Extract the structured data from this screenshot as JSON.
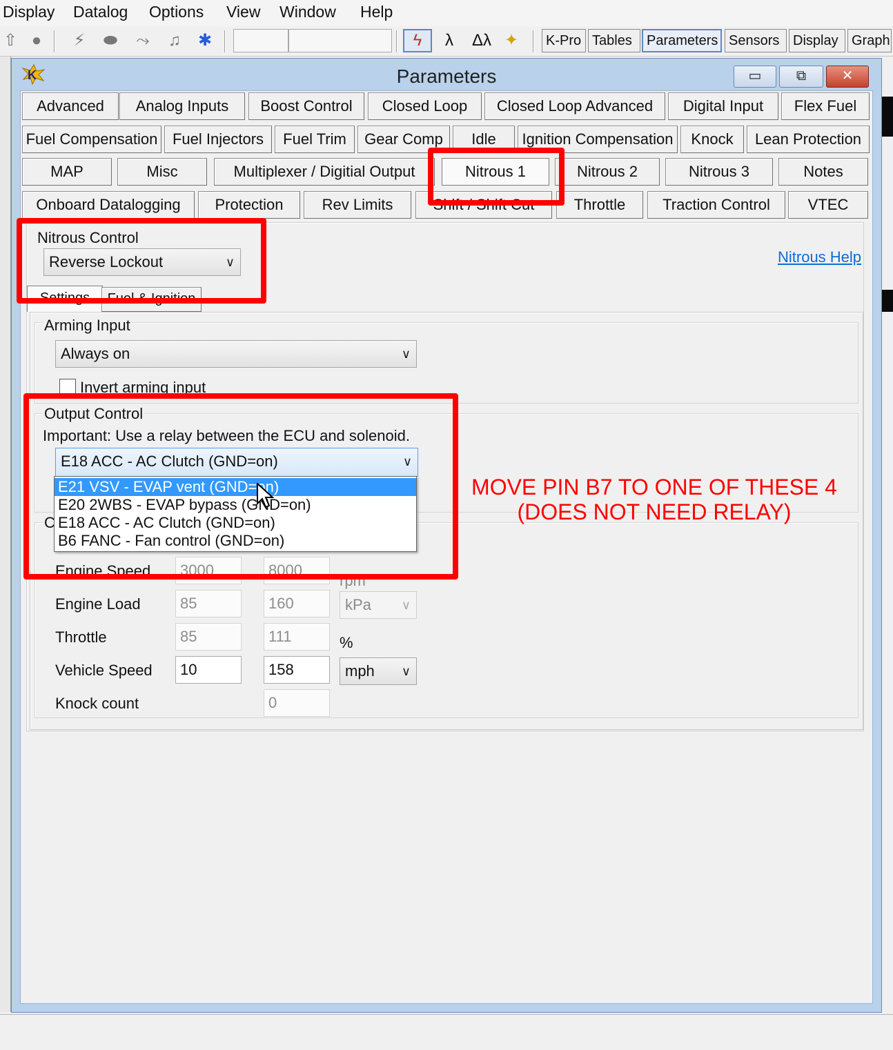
{
  "menubar": {
    "items": [
      "Display",
      "Datalog",
      "Options",
      "View",
      "Window",
      "Help"
    ]
  },
  "toolbar": {
    "view_tabs": [
      {
        "label": "K-Pro"
      },
      {
        "label": "Tables"
      },
      {
        "label": "Parameters"
      },
      {
        "label": "Sensors"
      },
      {
        "label": "Display"
      },
      {
        "label": "Graph"
      }
    ],
    "icons": [
      "up-arrow-icon",
      "record-icon",
      "flash-icon",
      "connect-icon",
      "route-icon",
      "sound-icon",
      "bluetooth-icon",
      "spark-icon",
      "lambda-icon",
      "dual-lambda-icon",
      "person-icon"
    ]
  },
  "window": {
    "title": "Parameters",
    "tabs": [
      "Advanced",
      "Analog Inputs",
      "Boost Control",
      "Closed Loop",
      "Closed Loop Advanced",
      "Digital Input",
      "Flex Fuel",
      "Fuel Compensation",
      "Fuel Injectors",
      "Fuel Trim",
      "Gear Comp",
      "Idle",
      "Ignition Compensation",
      "Knock",
      "Lean Protection",
      "MAP",
      "Misc",
      "Multiplexer / Digitial Output",
      "Nitrous 1",
      "Nitrous 2",
      "Nitrous 3",
      "Notes",
      "Onboard Datalogging",
      "Protection",
      "Rev Limits",
      "Shift / Shift Cut",
      "Throttle",
      "Traction Control",
      "VTEC"
    ],
    "selected_tab": "Nitrous 1",
    "nitrous_control": {
      "label": "Nitrous Control",
      "value": "Reverse Lockout"
    },
    "help_link": "Nitrous Help",
    "subtabs": [
      "Settings",
      "Fuel & Ignition"
    ],
    "arming": {
      "label": "Arming Input",
      "value": "Always on",
      "invert_label": "Invert arming input",
      "invert_checked": false
    },
    "output_control": {
      "label": "Output Control",
      "note": "Important: Use a relay between the ECU and solenoid.",
      "value": "E18 ACC - AC Clutch (GND=on)",
      "options": [
        "E21 VSV - EVAP vent (GND=on)",
        "E20 2WBS - EVAP bypass (GND=on)",
        "E18 ACC - AC Clutch (GND=on)",
        "B6 FANC - Fan control (GND=on)"
      ],
      "highlighted_option": "E21 VSV - EVAP vent (GND=on)"
    },
    "conditions": {
      "rows": [
        {
          "label": "Engine Speed",
          "min": "3000",
          "max": "8000",
          "unit": "rpm",
          "enabled": false
        },
        {
          "label": "Engine Load",
          "min": "85",
          "max": "160",
          "unit": "kPa",
          "enabled": false
        },
        {
          "label": "Throttle",
          "min": "85",
          "max": "111",
          "unit": "%",
          "enabled": false
        },
        {
          "label": "Vehicle Speed",
          "min": "10",
          "max": "158",
          "unit": "mph",
          "enabled": true
        },
        {
          "label": "Knock count",
          "min": "",
          "max": "0",
          "unit": "",
          "enabled": false
        }
      ]
    }
  },
  "annotation": {
    "line1": "MOVE PIN B7 TO ONE OF THESE 4",
    "line2": "(DOES NOT NEED RELAY)",
    "color": "#ff0000"
  },
  "colors": {
    "titlebar": "#b9d1ea",
    "highlight": "#3399ff",
    "annotation": "#ff0000",
    "link": "#0a6cd7"
  }
}
